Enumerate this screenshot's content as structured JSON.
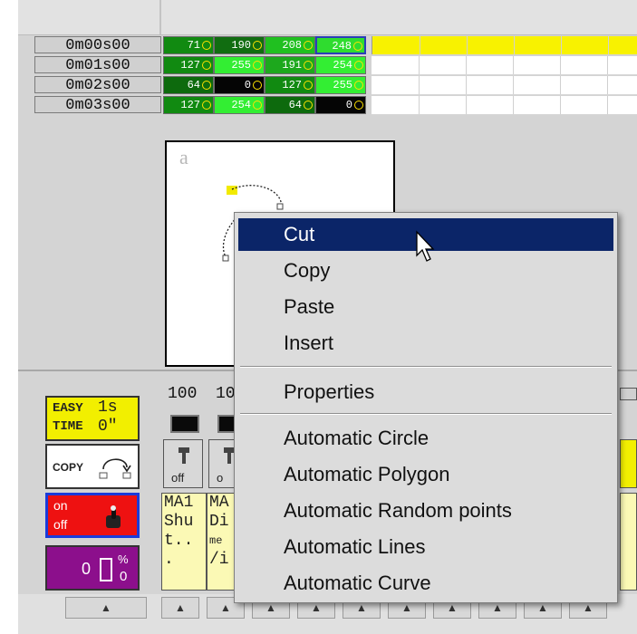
{
  "timeline": {
    "rows": [
      {
        "time": "0m00s00",
        "cells": [
          {
            "v": "71",
            "color": "#118a11"
          },
          {
            "v": "190",
            "color": "#116d11"
          },
          {
            "v": "208",
            "color": "#20c020"
          },
          {
            "v": "248",
            "color": "#2fdc2f"
          }
        ]
      },
      {
        "time": "0m01s00",
        "cells": [
          {
            "v": "127",
            "color": "#118a11"
          },
          {
            "v": "255",
            "color": "#33ee33"
          },
          {
            "v": "191",
            "color": "#1da81d"
          },
          {
            "v": "254",
            "color": "#33ee33"
          }
        ]
      },
      {
        "time": "0m02s00",
        "cells": [
          {
            "v": "64",
            "color": "#0d6a0d"
          },
          {
            "v": "0",
            "color": "#050505"
          },
          {
            "v": "127",
            "color": "#118a11"
          },
          {
            "v": "255",
            "color": "#33ee33"
          }
        ]
      },
      {
        "time": "0m03s00",
        "cells": [
          {
            "v": "127",
            "color": "#118a11"
          },
          {
            "v": "254",
            "color": "#33ee33"
          },
          {
            "v": "64",
            "color": "#0d6a0d"
          },
          {
            "v": "0",
            "color": "#050505"
          }
        ]
      }
    ]
  },
  "preview": {
    "glyph": "a"
  },
  "context_menu": {
    "items": [
      {
        "label": "Cut",
        "selected": true
      },
      {
        "label": "Copy"
      },
      {
        "label": "Paste"
      },
      {
        "label": "Insert"
      },
      {
        "label": "Properties"
      },
      {
        "label": "Automatic Circle"
      },
      {
        "label": "Automatic Polygon"
      },
      {
        "label": "Automatic Random points"
      },
      {
        "label": "Automatic Lines"
      },
      {
        "label": "Automatic Curve"
      }
    ]
  },
  "panel": {
    "easy_l1": "EASY",
    "easy_l2": "TIME",
    "easy_r1": "1s",
    "easy_r2": "0\"",
    "copy": "COPY",
    "on": "on",
    "off": "off",
    "percent_zero": "0",
    "percent_sign": "%",
    "percent_small": "0"
  },
  "channels": {
    "values": [
      "100",
      "10"
    ],
    "btn1_label": "off",
    "btn2_label": "o",
    "ch1_text": [
      "MA1",
      "Shu",
      "t..",
      "."
    ],
    "ch2_text": [
      "MA",
      "Di",
      "me",
      "/i"
    ]
  },
  "colors": {
    "menu_selected_bg": "#0b2568",
    "timeline_band": "#f8f200",
    "easy_bg": "#f2ef00",
    "onoff_bg": "#ee1111",
    "percent_bg": "#8c0f8c"
  }
}
